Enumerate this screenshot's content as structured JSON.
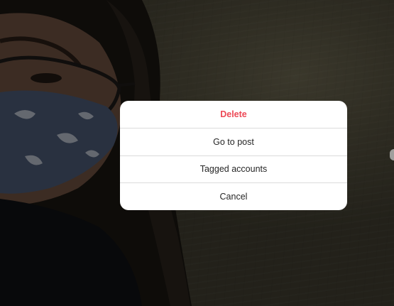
{
  "dialog": {
    "items": [
      {
        "label": "Delete",
        "style": "danger"
      },
      {
        "label": "Go to post",
        "style": "normal"
      },
      {
        "label": "Tagged accounts",
        "style": "normal"
      },
      {
        "label": "Cancel",
        "style": "normal"
      }
    ]
  },
  "colors": {
    "danger": "#ed4956",
    "text": "#262626",
    "separator": "#dbdbdb",
    "overlay": "rgba(0,0,0,0.45)"
  }
}
